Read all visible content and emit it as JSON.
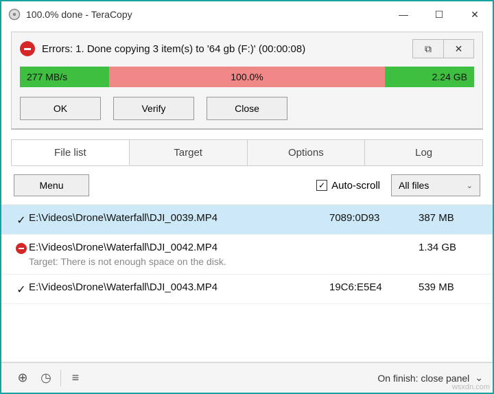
{
  "window": {
    "title": "100.0% done - TeraCopy"
  },
  "panel": {
    "status": "Errors: 1. Done copying 3 item(s) to '64 gb (F:)' (00:00:08)",
    "speed": "277 MB/s",
    "percent": "100.0%",
    "total": "2.24 GB",
    "buttons": {
      "ok": "OK",
      "verify": "Verify",
      "close": "Close"
    },
    "mini": {
      "restore": "⧉",
      "close": "✕"
    }
  },
  "tabs": [
    "File list",
    "Target",
    "Options",
    "Log"
  ],
  "toolbar": {
    "menu": "Menu",
    "autoscroll": "Auto-scroll",
    "filter": "All files"
  },
  "files": [
    {
      "status": "ok",
      "path": "E:\\Videos\\Drone\\Waterfall\\DJI_0039.MP4",
      "hash": "7089:0D93",
      "size": "387 MB",
      "selected": true
    },
    {
      "status": "error",
      "path": "E:\\Videos\\Drone\\Waterfall\\DJI_0042.MP4",
      "message": "Target: There is not enough space on the disk.",
      "hash": "",
      "size": "1.34 GB",
      "selected": false
    },
    {
      "status": "ok",
      "path": "E:\\Videos\\Drone\\Waterfall\\DJI_0043.MP4",
      "hash": "19C6:E5E4",
      "size": "539 MB",
      "selected": false
    }
  ],
  "footer": {
    "label": "On finish: close panel"
  },
  "watermark": "wsxdn.com"
}
